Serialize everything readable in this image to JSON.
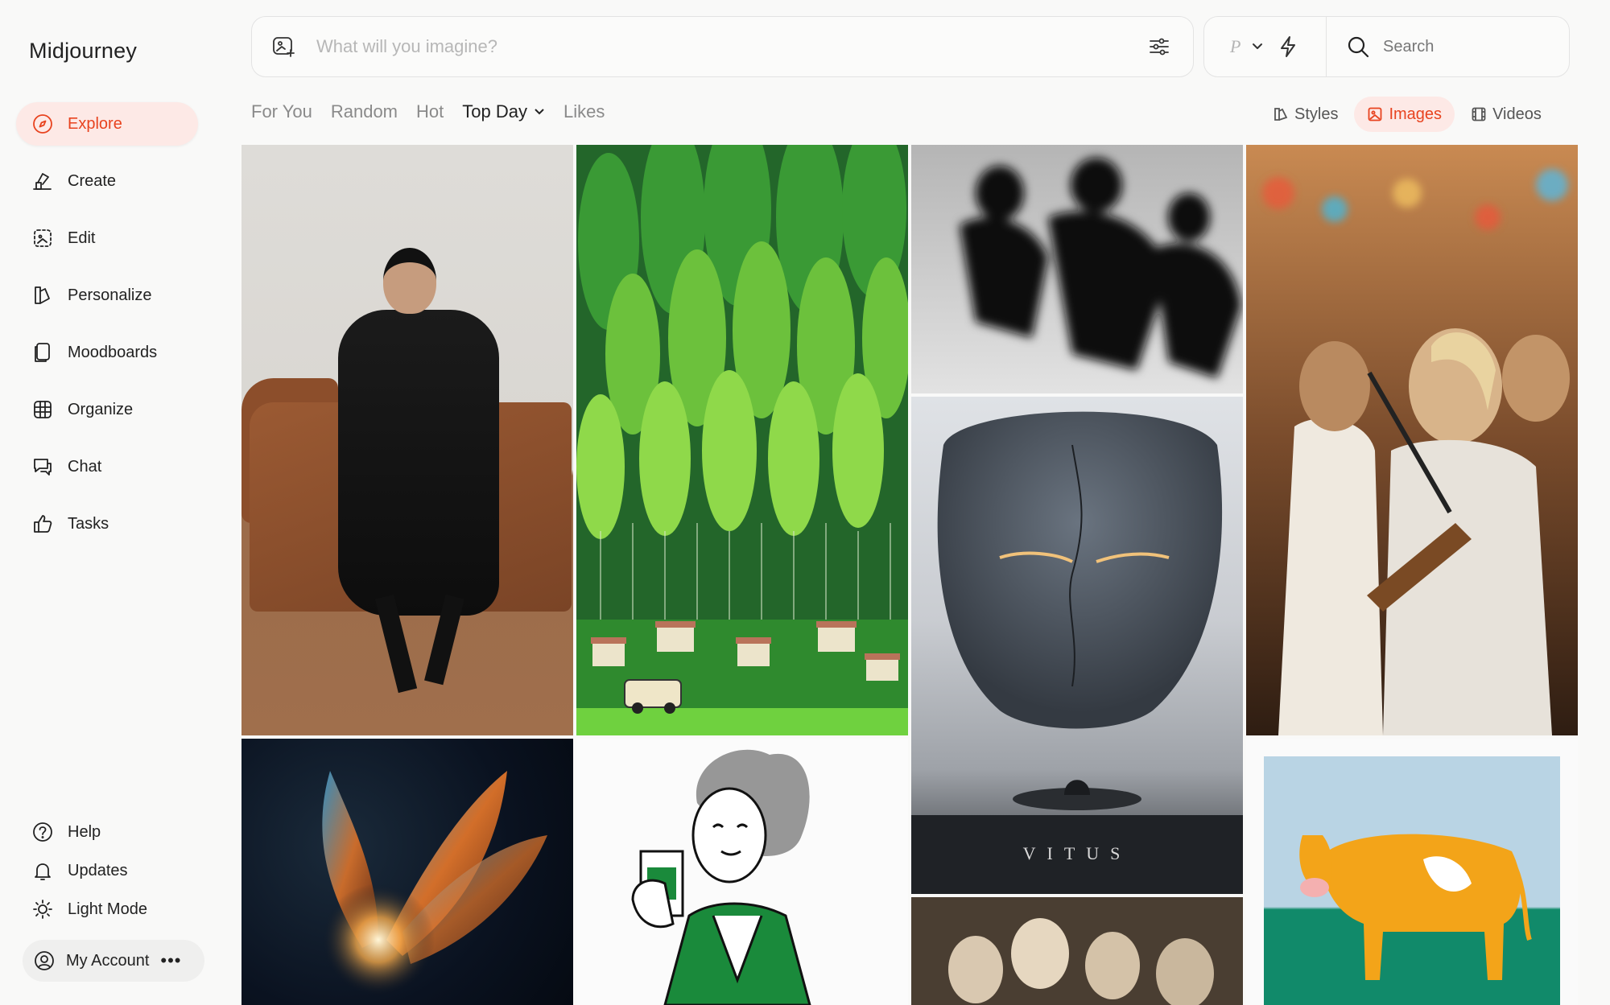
{
  "app": {
    "title": "Midjourney"
  },
  "sidebar": {
    "items": [
      {
        "label": "Explore",
        "icon": "compass-icon",
        "active": true
      },
      {
        "label": "Create",
        "icon": "brush-icon"
      },
      {
        "label": "Edit",
        "icon": "edit-frame-icon"
      },
      {
        "label": "Personalize",
        "icon": "personalize-icon"
      },
      {
        "label": "Moodboards",
        "icon": "moodboards-icon"
      },
      {
        "label": "Organize",
        "icon": "grid-icon"
      },
      {
        "label": "Chat",
        "icon": "chat-icon"
      },
      {
        "label": "Tasks",
        "icon": "thumbs-up-icon"
      }
    ],
    "bottom": [
      {
        "label": "Help",
        "icon": "help-icon"
      },
      {
        "label": "Updates",
        "icon": "bell-icon"
      },
      {
        "label": "Light Mode",
        "icon": "sun-icon"
      }
    ],
    "account": {
      "label": "My Account",
      "more": "•••"
    }
  },
  "prompt": {
    "placeholder": "What will you imagine?"
  },
  "topbar": {
    "p_label": "P",
    "search_placeholder": "Search"
  },
  "tabs": [
    {
      "label": "For You"
    },
    {
      "label": "Random"
    },
    {
      "label": "Hot"
    },
    {
      "label": "Top Day",
      "selected": true,
      "dropdown": true
    },
    {
      "label": "Likes"
    }
  ],
  "media_tabs": [
    {
      "label": "Styles",
      "icon": "styles-icon"
    },
    {
      "label": "Images",
      "icon": "image-icon",
      "selected": true
    },
    {
      "label": "Videos",
      "icon": "film-icon"
    }
  ],
  "colors": {
    "accent": "#e8431f",
    "accent_bg": "#fde9e6"
  }
}
